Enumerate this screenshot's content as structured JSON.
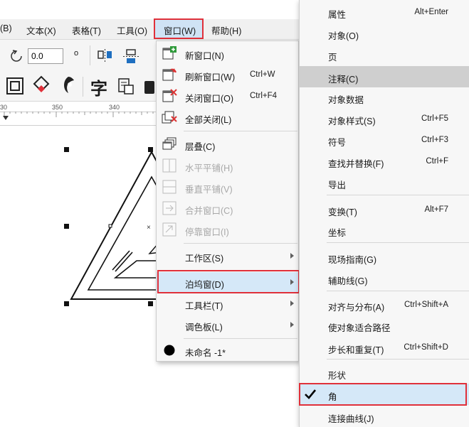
{
  "menubar": {
    "items": [
      "(B)",
      "文本(X)",
      "表格(T)",
      "工具(O)",
      "窗口(W)",
      "帮助(H)"
    ]
  },
  "toolbar": {
    "rotation_value": "0.0",
    "degree_symbol": "o",
    "text_tool_glyph": "字"
  },
  "ruler": {
    "ticks": [
      "30",
      "350",
      "340"
    ]
  },
  "window_menu": {
    "items": [
      {
        "label": "新窗口(N)",
        "shortcut": ""
      },
      {
        "label": "刷新窗口(W)",
        "shortcut": "Ctrl+W"
      },
      {
        "label": "关闭窗口(O)",
        "shortcut": "Ctrl+F4"
      },
      {
        "label": "全部关闭(L)",
        "shortcut": ""
      },
      {
        "label": "层叠(C)",
        "shortcut": ""
      },
      {
        "label": "水平平铺(H)",
        "shortcut": ""
      },
      {
        "label": "垂直平铺(V)",
        "shortcut": ""
      },
      {
        "label": "合并窗口(C)",
        "shortcut": ""
      },
      {
        "label": "停靠窗口(I)",
        "shortcut": ""
      },
      {
        "label": "工作区(S)",
        "shortcut": ""
      },
      {
        "label": "泊坞窗(D)",
        "shortcut": ""
      },
      {
        "label": "工具栏(T)",
        "shortcut": ""
      },
      {
        "label": "调色板(L)",
        "shortcut": ""
      },
      {
        "label": "未命名 -1*",
        "shortcut": ""
      }
    ]
  },
  "docker_menu": {
    "items": [
      {
        "label": "属性",
        "shortcut": "Alt+Enter"
      },
      {
        "label": "对象(O)",
        "shortcut": ""
      },
      {
        "label": "页",
        "shortcut": ""
      },
      {
        "label": "注释(C)",
        "shortcut": ""
      },
      {
        "label": "对象数据",
        "shortcut": ""
      },
      {
        "label": "对象样式(S)",
        "shortcut": "Ctrl+F5"
      },
      {
        "label": "符号",
        "shortcut": "Ctrl+F3"
      },
      {
        "label": "查找并替换(F)",
        "shortcut": "Ctrl+F"
      },
      {
        "label": "导出",
        "shortcut": ""
      },
      {
        "label": "变换(T)",
        "shortcut": "Alt+F7"
      },
      {
        "label": "坐标",
        "shortcut": ""
      },
      {
        "label": "现场指南(G)",
        "shortcut": ""
      },
      {
        "label": "辅助线(G)",
        "shortcut": ""
      },
      {
        "label": "对齐与分布(A)",
        "shortcut": "Ctrl+Shift+A"
      },
      {
        "label": "使对象适合路径",
        "shortcut": ""
      },
      {
        "label": "步长和重复(T)",
        "shortcut": "Ctrl+Shift+D"
      },
      {
        "label": "形状",
        "shortcut": ""
      },
      {
        "label": "角",
        "shortcut": ""
      },
      {
        "label": "连接曲线(J)",
        "shortcut": ""
      }
    ]
  },
  "colors": {
    "highlight_border": "#e0303a",
    "hover_blue": "#d5e8f8",
    "hover_gray": "#cfcfcf",
    "accent_blue": "#1f6fc0"
  }
}
